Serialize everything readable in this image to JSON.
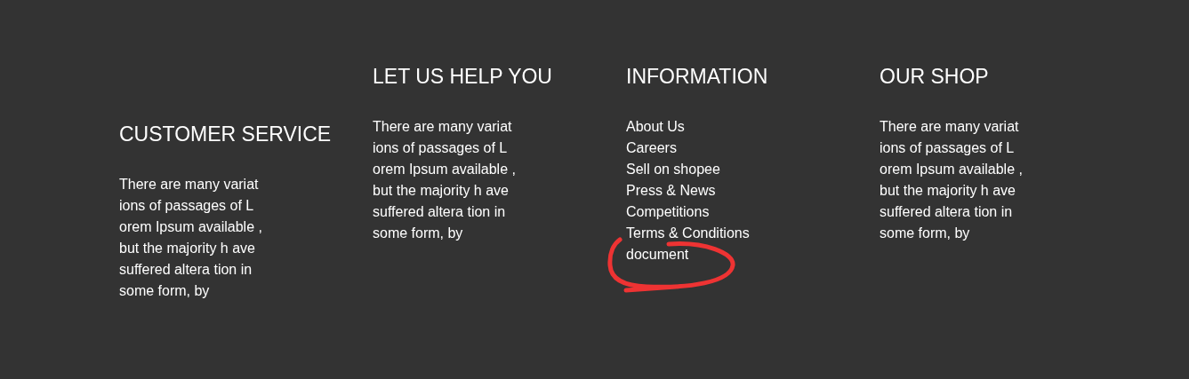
{
  "columns": [
    {
      "heading": "CUSTOMER SERVICE",
      "kind": "text",
      "text": "There are many variat\nions of passages of L\norem Ipsum available ,\nbut the majority h ave\nsuffered altera tion in\nsome form, by"
    },
    {
      "heading": "LET US HELP YOU",
      "kind": "text",
      "text": "There are many variat\nions of passages of L\norem Ipsum available ,\nbut the majority h ave\nsuffered altera tion in\nsome form, by"
    },
    {
      "heading": "INFORMATION",
      "kind": "links",
      "links": [
        {
          "label": "About Us",
          "circled": false
        },
        {
          "label": "Careers",
          "circled": false
        },
        {
          "label": "Sell on shopee",
          "circled": false
        },
        {
          "label": "Press & News",
          "circled": false
        },
        {
          "label": "Competitions",
          "circled": false
        },
        {
          "label": "Terms & Conditions",
          "circled": false
        },
        {
          "label": "document",
          "circled": true
        }
      ]
    },
    {
      "heading": "OUR SHOP",
      "kind": "text",
      "text": "There are many variat\nions of passages of L\norem Ipsum available ,\nbut the majority h ave\nsuffered altera tion in\nsome form, by"
    }
  ]
}
